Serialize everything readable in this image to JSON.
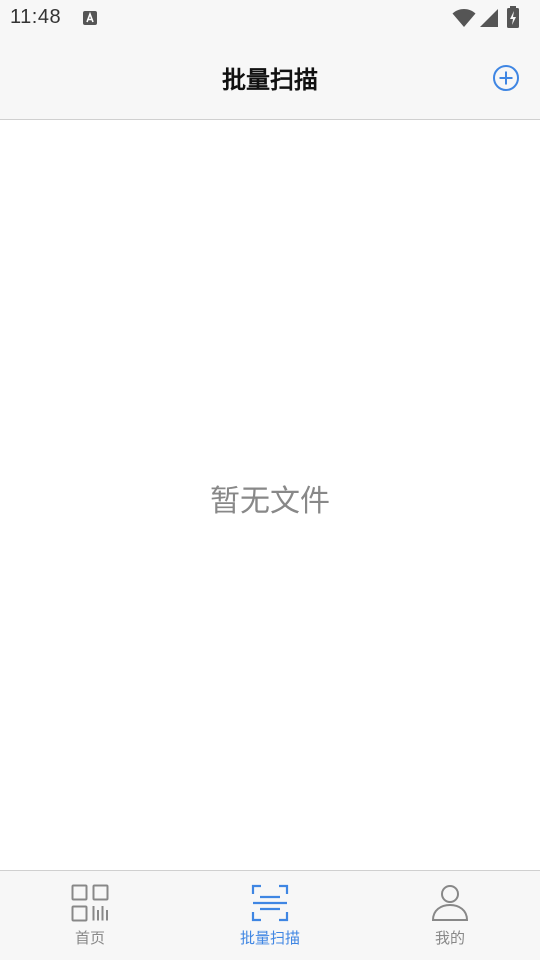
{
  "status_bar": {
    "time": "11:48",
    "icons": [
      "app-notification-icon",
      "wifi-icon",
      "cell-signal-icon",
      "battery-charging-icon"
    ]
  },
  "header": {
    "title": "批量扫描",
    "add_icon": "plus-circle-icon"
  },
  "main": {
    "empty_message": "暂无文件"
  },
  "tab_bar": {
    "tabs": [
      {
        "label": "首页",
        "icon": "qr-code-icon",
        "active": false
      },
      {
        "label": "批量扫描",
        "icon": "scan-icon",
        "active": true
      },
      {
        "label": "我的",
        "icon": "user-icon",
        "active": false
      }
    ]
  },
  "colors": {
    "accent": "#3f86e3",
    "inactive": "#888888",
    "bar_background": "#f7f7f7"
  }
}
